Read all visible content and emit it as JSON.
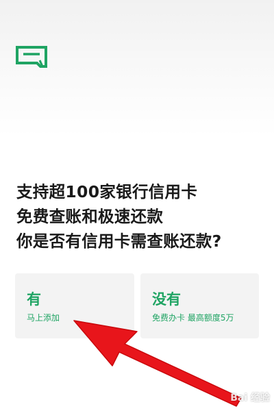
{
  "headline": {
    "line1": "支持超100家银行信用卡",
    "line2": "免费查账和极速还款",
    "line3": "你是否有信用卡需查账还款?"
  },
  "options": {
    "yes": {
      "title": "有",
      "subtitle": "马上添加"
    },
    "no": {
      "title": "没有",
      "subtitle": "免费办卡 最高额度5万"
    }
  },
  "watermark": "Bai 经验",
  "colors": {
    "accent": "#1fa463",
    "card_bg": "#f3f3f3",
    "arrow": "#e8151b",
    "text": "#1a1a1a"
  },
  "icons": {
    "logo": "card-logo-icon"
  }
}
